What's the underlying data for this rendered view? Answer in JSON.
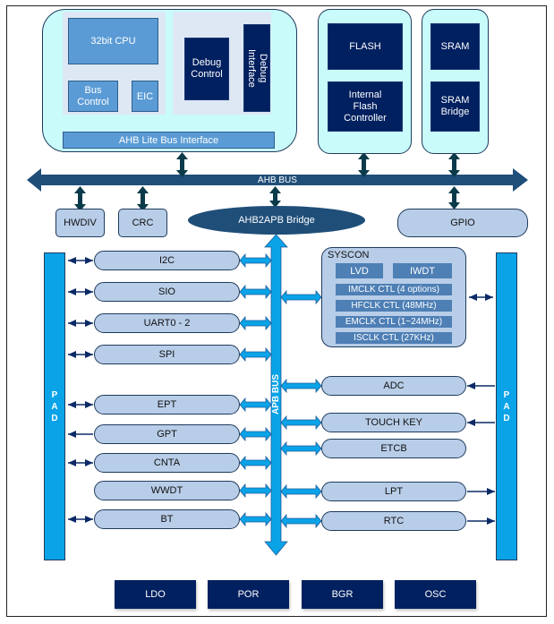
{
  "core": {
    "cpu": "32bit CPU",
    "bus_control": "Bus Control",
    "eic": "EIC",
    "debug_control": "Debug Control",
    "debug_interface": "Debug Interface",
    "ahb_lite": "AHB Lite Bus Interface"
  },
  "memory": {
    "flash": "FLASH",
    "flash_controller": "Internal Flash Controller",
    "sram": "SRAM",
    "sram_bridge": "SRAM Bridge"
  },
  "buses": {
    "ahb": "AHB BUS",
    "apb": "APB BUS",
    "bridge": "AHB2APB Bridge"
  },
  "ahb_peripherals": {
    "hwdiv": "HWDIV",
    "crc": "CRC",
    "gpio": "GPIO"
  },
  "pad_label": "PAD",
  "left_peripherals": [
    {
      "label": "I2C",
      "pad_link": "bidirectional"
    },
    {
      "label": "SIO",
      "pad_link": "bidirectional"
    },
    {
      "label": "UART0 - 2",
      "pad_link": "bidirectional"
    },
    {
      "label": "SPI",
      "pad_link": "bidirectional"
    },
    {
      "label": "EPT",
      "pad_link": "bidirectional"
    },
    {
      "label": "GPT",
      "pad_link": "output"
    },
    {
      "label": "CNTA",
      "pad_link": "bidirectional"
    },
    {
      "label": "WWDT",
      "pad_link": "none"
    },
    {
      "label": "BT",
      "pad_link": "bidirectional"
    }
  ],
  "syscon": {
    "title": "SYSCON",
    "lvd": "LVD",
    "iwdt": "IWDT",
    "items": [
      "IMCLK CTL (4 options)",
      "HFCLK CTL (48MHz)",
      "EMCLK CTL (1~24MHz)",
      "ISCLK CTL (27KHz)"
    ]
  },
  "right_peripherals": [
    {
      "label": "ADC",
      "pad_link": "input"
    },
    {
      "label": "TOUCH KEY",
      "pad_link": "input"
    },
    {
      "label": "ETCB",
      "pad_link": "none"
    },
    {
      "label": "LPT",
      "pad_link": "output"
    },
    {
      "label": "RTC",
      "pad_link": "output"
    }
  ],
  "power_blocks": [
    "LDO",
    "POR",
    "BGR",
    "OSC"
  ],
  "colors": {
    "navy": "#002060",
    "mid_blue": "#5b9bd5",
    "pad_blue": "#0aa3e8",
    "bus_dark": "#1f4e79",
    "pill_fill": "#b8cde8",
    "group_fill": "#c9fbfb",
    "connector_dark": "#0b3a4a"
  }
}
